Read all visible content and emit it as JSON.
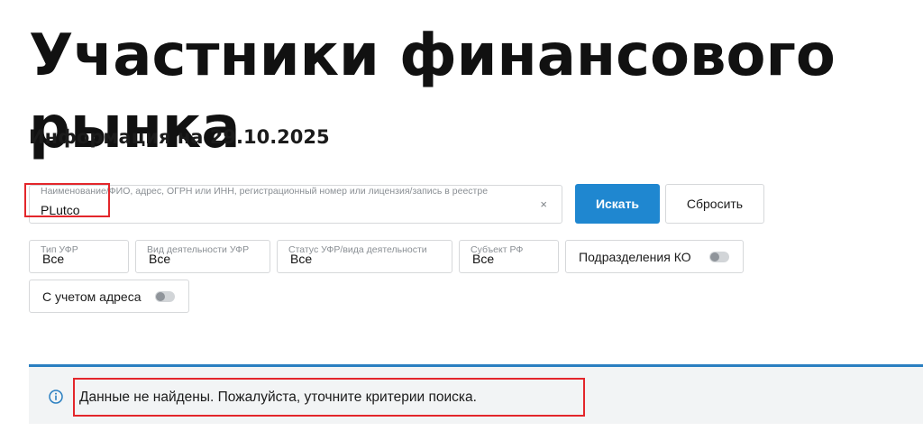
{
  "page": {
    "title": "Участники финансового рынка",
    "subtitle": "Информация на 29.10.2025"
  },
  "search": {
    "label": "Наименование/ФИО, адрес, ОГРН или ИНН, регистрационный номер или лицензия/запись в реестре",
    "value": "PLutco",
    "clear": "×",
    "submit_label": "Искать",
    "reset_label": "Сбросить"
  },
  "filters": [
    {
      "label": "Тип УФР",
      "value": "Все"
    },
    {
      "label": "Вид деятельности УФР",
      "value": "Все"
    },
    {
      "label": "Статус УФР/вида деятельности",
      "value": "Все"
    },
    {
      "label": "Субъект РФ",
      "value": "Все"
    }
  ],
  "toggles": {
    "ko_divisions": {
      "label": "Подразделения КО",
      "on": false
    },
    "with_address": {
      "label": "С учетом адреса",
      "on": false
    }
  },
  "alert": {
    "icon": "info-icon",
    "message": "Данные не найдены. Пожалуйста, уточните критерии поиска."
  },
  "colors": {
    "accent": "#1f87d0",
    "highlight": "#e3262b",
    "alert_border": "#2a7fc1"
  }
}
